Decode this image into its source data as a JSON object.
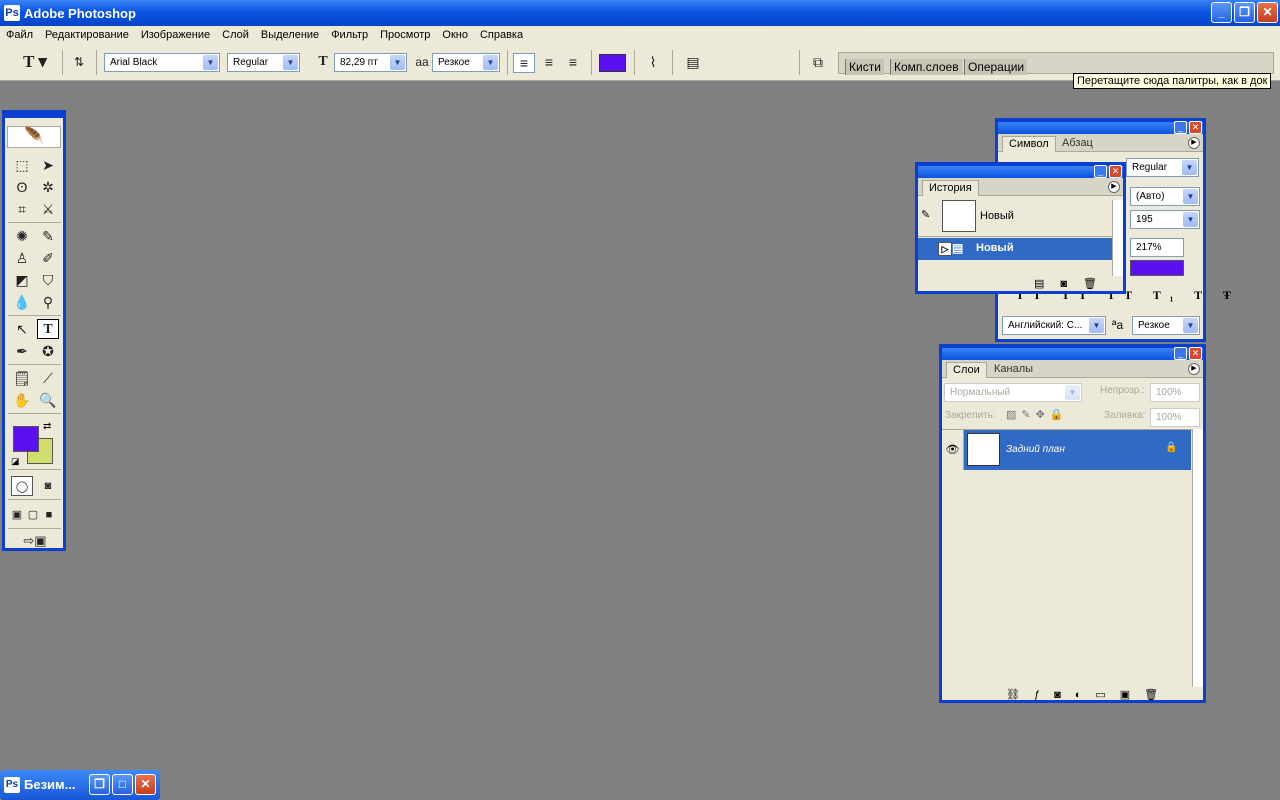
{
  "window": {
    "title": "Adobe Photoshop",
    "app_icon": "photoshop-icon"
  },
  "menu": [
    "Файл",
    "Редактирование",
    "Изображение",
    "Слой",
    "Выделение",
    "Фильтр",
    "Просмотр",
    "Окно",
    "Справка"
  ],
  "options": {
    "font_family": "Arial Black",
    "font_style": "Regular",
    "font_size": "82,29 пт",
    "antialias": "Резкое",
    "text_color": "#5a10f0",
    "tool_glyph": "T",
    "aa_glyph": "aa"
  },
  "palette_well": {
    "tabs": [
      "Кисти",
      "Комп.слоев",
      "Операции"
    ]
  },
  "tooltip": "Перетащите сюда палитры, как в док",
  "toolbox": {
    "foreground_color": "#5a10f0",
    "background_color": "#d3dd6c"
  },
  "symbol_panel": {
    "tabs": [
      "Символ",
      "Абзац"
    ],
    "font_style": "Regular",
    "leading": "(Авто)",
    "tracking": "195",
    "scale": "217%",
    "color": "#5a10f0",
    "language": "Английский: С...",
    "antialias": "Резкое"
  },
  "history_panel": {
    "tab": "История",
    "snapshot_label": "Новый",
    "items": [
      {
        "label": "Новый"
      }
    ]
  },
  "layers_panel": {
    "tabs": [
      "Слои",
      "Каналы"
    ],
    "blend_mode": "Нормальный",
    "opacity_label": "Непрозр.:",
    "opacity": "100%",
    "lock_label": "Закрепить:",
    "fill_label": "Заливка:",
    "fill": "100%",
    "layers": [
      {
        "name": "Задний план",
        "visible": true,
        "locked": true
      }
    ]
  },
  "taskbar": {
    "button_label": "Безим..."
  }
}
